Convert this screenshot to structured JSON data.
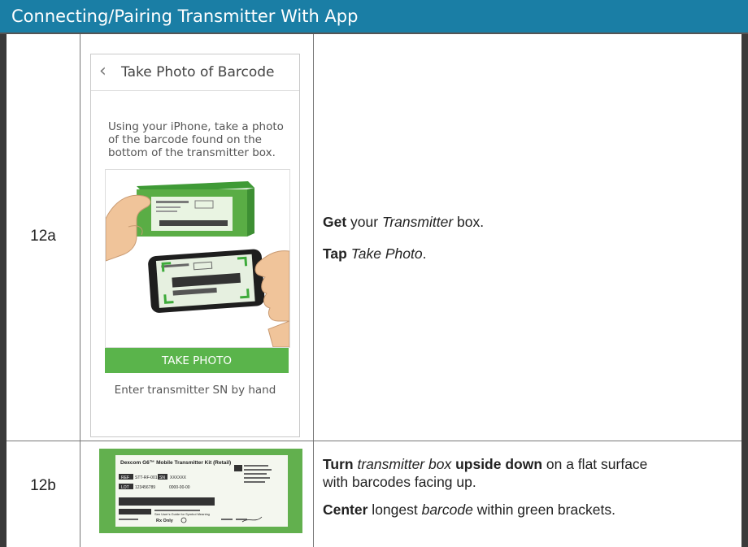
{
  "header": {
    "title": "Connecting/Pairing Transmitter With App"
  },
  "rows": [
    {
      "step": "12a",
      "phone": {
        "title": "Take Photo of Barcode",
        "instruction": "Using your iPhone, take a photo of the barcode found on the bottom of the transmitter box.",
        "take_photo_label": "TAKE PHOTO",
        "enter_sn_label": "Enter transmitter SN by hand"
      },
      "lines": [
        {
          "bold": "Get",
          "pre": " your ",
          "italic": "Transmitter",
          "post": " box."
        },
        {
          "bold": "Tap",
          "pre": " ",
          "italic": "Take Photo",
          "post": "."
        }
      ]
    },
    {
      "step": "12b",
      "label": {
        "title": "Dexcom G6™ Mobile Transmitter Kit (Retail)",
        "ref_tag": "REF",
        "ref": "STT-RF-001",
        "sn_tag": "SN",
        "sn": "XXXXXX",
        "lot_tag": "LOT",
        "lot": "123456789",
        "date": "0000-00-00",
        "rx_only": "Rx Only",
        "note": "See User's Guide for Symbol Meaning"
      },
      "lines": [
        {
          "bold": "Turn",
          "pre": " ",
          "italic": "transmitter box",
          "post": " ",
          "bold2": "upside down",
          "post2": " on a flat surface"
        },
        {
          "text": "with barcodes facing up."
        },
        {
          "bold": "Center",
          "pre": " longest ",
          "italic": "barcode",
          "post": " within green brackets."
        }
      ]
    }
  ],
  "colors": {
    "header_bg": "#1a7ea5",
    "button_green": "#5ab44b",
    "label_green": "#62b04e"
  }
}
